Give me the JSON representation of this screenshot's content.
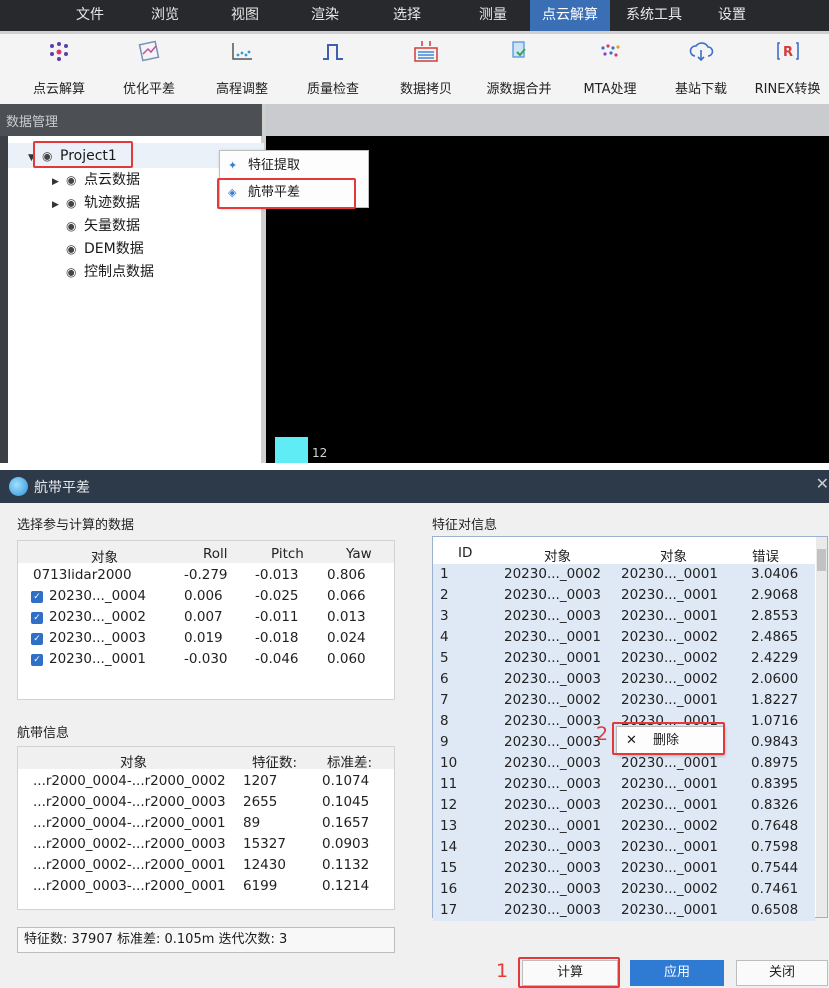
{
  "menu": [
    "文件",
    "浏览",
    "视图",
    "渲染",
    "选择",
    "测量",
    "点云解算",
    "系统工具",
    "设置"
  ],
  "menu_active": "点云解算",
  "toolbar": [
    {
      "label": "点云解算",
      "icon": "cloud-solve-icon"
    },
    {
      "label": "优化平差",
      "icon": "optimize-adjust-icon"
    },
    {
      "label": "高程调整",
      "icon": "elevation-adjust-icon"
    },
    {
      "label": "质量检查",
      "icon": "quality-check-icon"
    },
    {
      "label": "数据拷贝",
      "icon": "data-copy-icon"
    },
    {
      "label": "源数据合并",
      "icon": "source-merge-icon"
    },
    {
      "label": "MTA处理",
      "icon": "mta-icon"
    },
    {
      "label": "基站下载",
      "icon": "cloud-download-icon"
    },
    {
      "label": "RINEX转换",
      "icon": "rinex-icon"
    }
  ],
  "panel_title": "数据管理",
  "tree": {
    "root": "Project1",
    "children": [
      "点云数据",
      "轨迹数据",
      "矢量数据",
      "DEM数据",
      "控制点数据"
    ]
  },
  "context_menu1": [
    "特征提取",
    "航带平差"
  ],
  "viewport_label": "12",
  "dialog": {
    "title": "航带平差",
    "select_label": "选择参与计算的数据",
    "data_cols": [
      "对象",
      "Roll",
      "Pitch",
      "Yaw"
    ],
    "data_rows": [
      {
        "obj": "0713lidar2000",
        "roll": "-0.279",
        "pitch": "-0.013",
        "yaw": "0.806",
        "checked": false
      },
      {
        "obj": "20230..._0004",
        "roll": "0.006",
        "pitch": "-0.025",
        "yaw": "0.066",
        "checked": true
      },
      {
        "obj": "20230..._0002",
        "roll": "0.007",
        "pitch": "-0.011",
        "yaw": "0.013",
        "checked": true
      },
      {
        "obj": "20230..._0003",
        "roll": "0.019",
        "pitch": "-0.018",
        "yaw": "0.024",
        "checked": true
      },
      {
        "obj": "20230..._0001",
        "roll": "-0.030",
        "pitch": "-0.046",
        "yaw": "0.060",
        "checked": true
      }
    ],
    "strip_label": "航带信息",
    "strip_cols": [
      "对象",
      "特征数:",
      "标准差:"
    ],
    "strip_rows": [
      {
        "obj": "...r2000_0004-...r2000_0002",
        "n": "1207",
        "sd": "0.1074"
      },
      {
        "obj": "...r2000_0004-...r2000_0003",
        "n": "2655",
        "sd": "0.1045"
      },
      {
        "obj": "...r2000_0004-...r2000_0001",
        "n": "89",
        "sd": "0.1657"
      },
      {
        "obj": "...r2000_0002-...r2000_0003",
        "n": "15327",
        "sd": "0.0903"
      },
      {
        "obj": "...r2000_0002-...r2000_0001",
        "n": "12430",
        "sd": "0.1132"
      },
      {
        "obj": "...r2000_0003-...r2000_0001",
        "n": "6199",
        "sd": "0.1214"
      }
    ],
    "status": "特征数: 37907 标准差: 0.105m 迭代次数: 3",
    "pair_label": "特征对信息",
    "pair_cols": [
      "ID",
      "对象",
      "对象",
      "错误"
    ],
    "pair_rows": [
      {
        "id": "1",
        "a": "20230..._0002",
        "b": "20230..._0001",
        "e": "3.0406"
      },
      {
        "id": "2",
        "a": "20230..._0003",
        "b": "20230..._0001",
        "e": "2.9068"
      },
      {
        "id": "3",
        "a": "20230..._0003",
        "b": "20230..._0001",
        "e": "2.8553"
      },
      {
        "id": "4",
        "a": "20230..._0001",
        "b": "20230..._0002",
        "e": "2.4865"
      },
      {
        "id": "5",
        "a": "20230..._0001",
        "b": "20230..._0002",
        "e": "2.4229"
      },
      {
        "id": "6",
        "a": "20230..._0003",
        "b": "20230..._0002",
        "e": "2.0600"
      },
      {
        "id": "7",
        "a": "20230..._0002",
        "b": "20230..._0001",
        "e": "1.8227"
      },
      {
        "id": "8",
        "a": "20230..._0003",
        "b": "20230..._0001",
        "e": "1.0716"
      },
      {
        "id": "9",
        "a": "20230..._0003",
        "b": "",
        "e": "0.9843"
      },
      {
        "id": "10",
        "a": "20230..._0003",
        "b": "20230..._0001",
        "e": "0.8975"
      },
      {
        "id": "11",
        "a": "20230..._0003",
        "b": "20230..._0001",
        "e": "0.8395"
      },
      {
        "id": "12",
        "a": "20230..._0003",
        "b": "20230..._0001",
        "e": "0.8326"
      },
      {
        "id": "13",
        "a": "20230..._0001",
        "b": "20230..._0002",
        "e": "0.7648"
      },
      {
        "id": "14",
        "a": "20230..._0003",
        "b": "20230..._0001",
        "e": "0.7598"
      },
      {
        "id": "15",
        "a": "20230..._0003",
        "b": "20230..._0001",
        "e": "0.7544"
      },
      {
        "id": "16",
        "a": "20230..._0003",
        "b": "20230..._0002",
        "e": "0.7461"
      },
      {
        "id": "17",
        "a": "20230..._0003",
        "b": "20230..._0001",
        "e": "0.6508"
      }
    ],
    "delete_menu": "删除",
    "buttons": {
      "compute": "计算",
      "apply": "应用",
      "close": "关闭"
    },
    "annotations": {
      "one": "1",
      "two": "2"
    }
  },
  "colors": {
    "accent": "#2f7ad3",
    "highlight": "#e23a3a",
    "titlebar": "#2d3a4a",
    "menubar": "#27292c"
  }
}
